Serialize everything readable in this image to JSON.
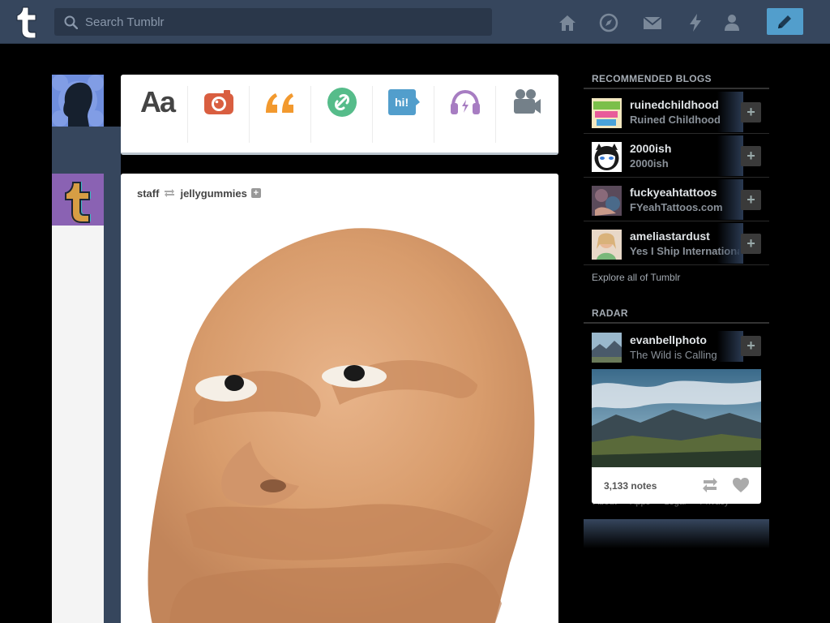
{
  "topbar": {
    "search_placeholder": "Search Tumblr",
    "nav": [
      {
        "icon": "home-icon"
      },
      {
        "icon": "explore-compass-icon"
      },
      {
        "icon": "inbox-mail-icon"
      },
      {
        "icon": "activity-lightning-icon"
      },
      {
        "icon": "account-person-icon"
      }
    ],
    "compose_icon": "pencil-icon"
  },
  "post_types": [
    {
      "name": "text",
      "label": "Aa",
      "color": "#444444"
    },
    {
      "name": "photo",
      "icon": "camera-icon",
      "color": "#d95e40"
    },
    {
      "name": "quote",
      "label": "“",
      "color": "#f2992e"
    },
    {
      "name": "link",
      "icon": "link-icon",
      "color": "#56bc8a"
    },
    {
      "name": "chat",
      "label": "hi!",
      "color": "#529ecc"
    },
    {
      "name": "audio",
      "icon": "headphones-icon",
      "color": "#a77dc2"
    },
    {
      "name": "video",
      "icon": "video-camera-icon",
      "color": "#748089"
    }
  ],
  "post": {
    "author": "staff",
    "reblogged_from": "jellygummies",
    "follow_label": "+"
  },
  "sidebar": {
    "recommended_title": "RECOMMENDED BLOGS",
    "recommended": [
      {
        "name": "ruinedchildhood",
        "title": "Ruined Childhood"
      },
      {
        "name": "2000ish",
        "title": "2000ish"
      },
      {
        "name": "fuckyeahtattoos",
        "title": "FYeahTattoos.com"
      },
      {
        "name": "ameliastardust",
        "title": "Yes I Ship International"
      }
    ],
    "follow_label": "+",
    "explore_label": "Explore all of Tumblr",
    "radar_title": "RADAR",
    "radar": {
      "name": "evanbellphoto",
      "title": "The Wild is Calling",
      "notes": "3,133 notes"
    },
    "footer_links": [
      "About",
      "Apps",
      "Legal",
      "Privacy"
    ]
  },
  "colors": {
    "topbar": "#36465d",
    "accent": "#529ecc",
    "background": "#000000"
  }
}
